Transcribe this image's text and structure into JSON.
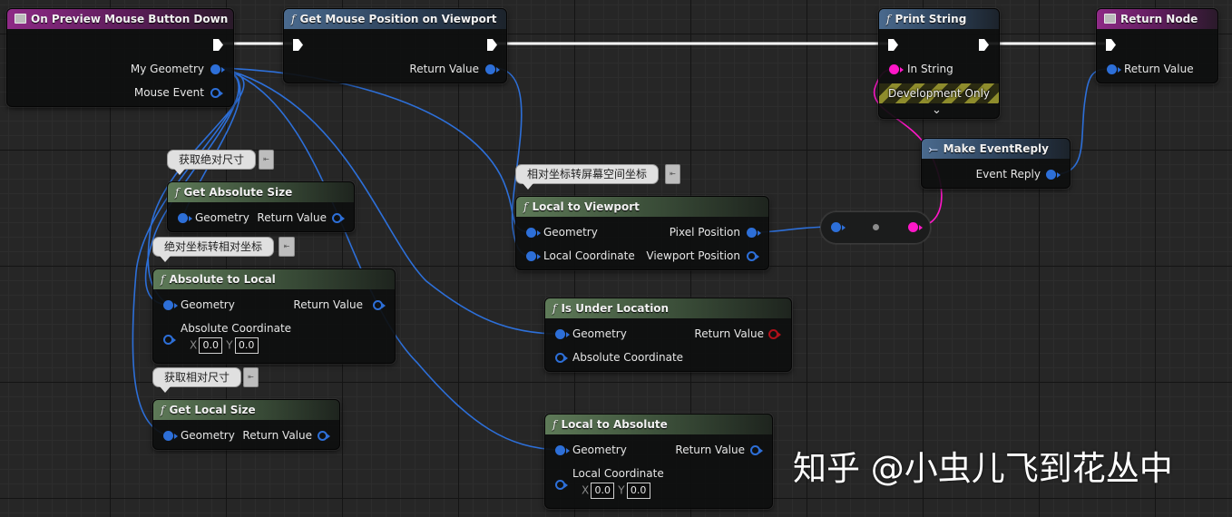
{
  "nodes": {
    "on_preview": {
      "title": "On Preview Mouse Button Down",
      "pins": {
        "my_geometry": "My Geometry",
        "mouse_event": "Mouse Event"
      }
    },
    "get_mouse_pos": {
      "title": "Get Mouse Position on Viewport",
      "pins": {
        "return_value": "Return Value"
      }
    },
    "print_string": {
      "title": "Print String",
      "pins": {
        "in_string": "In String"
      },
      "dev_only": "Development Only",
      "chevron": "⌄"
    },
    "return_node": {
      "title": "Return Node",
      "pins": {
        "return_value": "Return Value"
      }
    },
    "make_event_reply": {
      "title": "Make EventReply",
      "pins": {
        "event_reply": "Event Reply"
      }
    },
    "get_absolute_size": {
      "comment": "获取绝对尺寸",
      "title": "Get Absolute Size",
      "pins": {
        "geometry": "Geometry",
        "return_value": "Return Value"
      }
    },
    "absolute_to_local": {
      "comment": "绝对坐标转相对坐标",
      "title": "Absolute to Local",
      "pins": {
        "geometry": "Geometry",
        "return_value": "Return Value",
        "absolute_coordinate": "Absolute Coordinate"
      },
      "x_label": "X",
      "x_value": "0.0",
      "y_label": "Y",
      "y_value": "0.0"
    },
    "get_local_size": {
      "comment": "获取相对尺寸",
      "title": "Get Local Size",
      "pins": {
        "geometry": "Geometry",
        "return_value": "Return Value"
      }
    },
    "local_to_viewport": {
      "comment": "相对坐标转屏幕空间坐标",
      "title": "Local to Viewport",
      "pins": {
        "geometry": "Geometry",
        "local_coordinate": "Local Coordinate",
        "pixel_position": "Pixel Position",
        "viewport_position": "Viewport Position"
      }
    },
    "is_under_location": {
      "title": "Is Under Location",
      "pins": {
        "geometry": "Geometry",
        "return_value": "Return Value",
        "absolute_coordinate": "Absolute Coordinate"
      }
    },
    "local_to_absolute": {
      "title": "Local to Absolute",
      "pins": {
        "geometry": "Geometry",
        "return_value": "Return Value",
        "local_coordinate": "Local Coordinate"
      },
      "x_label": "X",
      "x_value": "0.0",
      "y_label": "Y",
      "y_value": "0.0"
    }
  },
  "comment_tab_glyph": "⇤",
  "watermark": "知乎 @小虫儿飞到花丛中",
  "colors": {
    "exec": "#ffffff",
    "struct_pin": "#2d6fd8",
    "string_pin": "#ff17c8",
    "bool_pin": "#b0101a",
    "event_header": "#8e2a86",
    "function_header": "#4a6a8e",
    "pure_header": "#5e7a58"
  }
}
